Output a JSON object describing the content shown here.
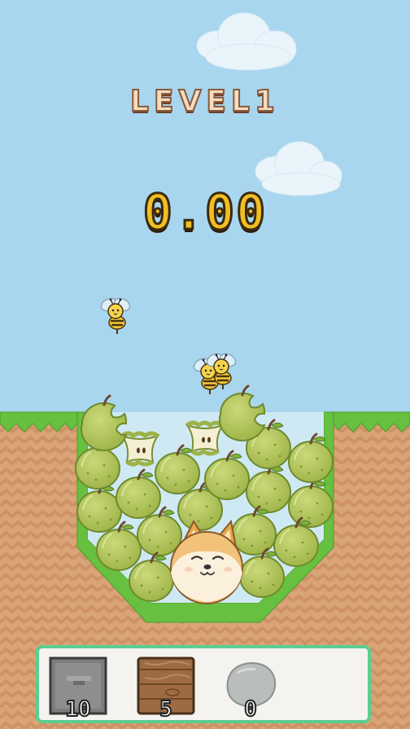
{
  "level": {
    "title": "LEVEL1"
  },
  "timer": {
    "value": "0.00"
  },
  "toolbar": {
    "tools": [
      {
        "name": "stone-block",
        "count": "10"
      },
      {
        "name": "wood-block",
        "count": "5"
      },
      {
        "name": "rock",
        "count": "0"
      }
    ]
  },
  "colors": {
    "sky": "#a9d6ef",
    "grass": "#67c03f",
    "dirt": "#d9a477",
    "apple": "#b3c759",
    "toolbar_border": "#5ccd90"
  }
}
